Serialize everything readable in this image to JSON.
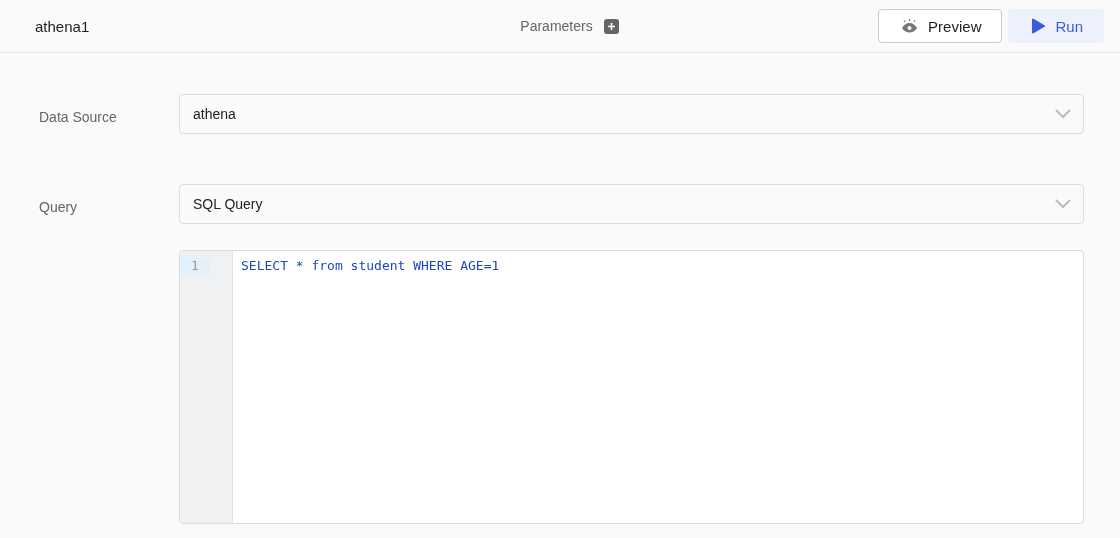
{
  "header": {
    "title": "athena1",
    "parameters_label": "Parameters",
    "buttons": [
      {
        "kind": "preview",
        "label": "Preview"
      },
      {
        "kind": "run",
        "label": "Run"
      }
    ]
  },
  "fields": [
    {
      "label": "Data Source",
      "value": "athena"
    },
    {
      "label": "Query",
      "value": "SQL Query"
    }
  ],
  "editor": {
    "lines": [
      {
        "number": "1",
        "code": "SELECT * from student WHERE AGE=1",
        "active": true
      }
    ]
  }
}
